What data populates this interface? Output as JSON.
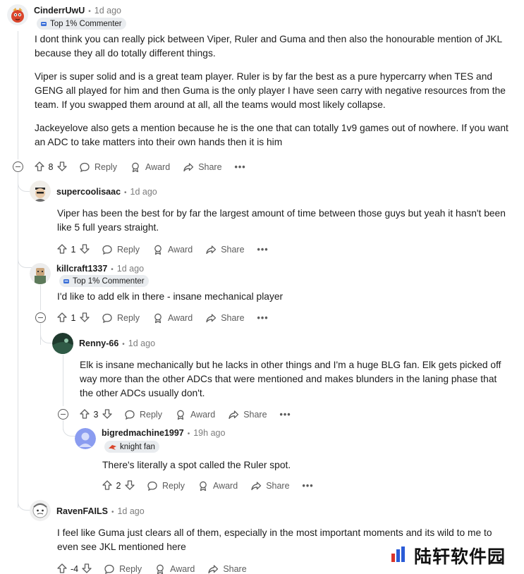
{
  "comments": [
    {
      "author": "CinderrUwU",
      "time": "1d ago",
      "flair": "Top 1% Commenter",
      "paragraphs": [
        "I dont think you can really pick between Viper, Ruler and Guma and then also the honourable mention of JKL because they all do totally different things.",
        "Viper is super solid and is a great team player. Ruler is by far the best as a pure hypercarry when TES and GENG all played for him and then Guma is the only player I have seen carry with negative resources from the team. If you swapped them around at all, all the teams would most likely collapse.",
        "Jackeyelove also gets a mention because he is the one that can totally 1v9 games out of nowhere. If you want an ADC to take matters into their own hands then it is him"
      ],
      "votes": "8"
    },
    {
      "author": "supercoolisaac",
      "time": "1d ago",
      "paragraphs": [
        "Viper has been the best for by far the largest amount of time between those guys but yeah it hasn't been like 5 full years straight."
      ],
      "votes": "1"
    },
    {
      "author": "killcraft1337",
      "time": "1d ago",
      "flair": "Top 1% Commenter",
      "paragraphs": [
        "I'd like to add elk in there - insane mechanical player"
      ],
      "votes": "1"
    },
    {
      "author": "Renny-66",
      "time": "1d ago",
      "paragraphs": [
        "Elk is insane mechanically but he lacks in other things and I'm a huge BLG fan. Elk gets picked off way more than the other ADCs that were mentioned and makes blunders in the laning phase that the other ADCs usually don't."
      ],
      "votes": "3"
    },
    {
      "author": "bigredmachine1997",
      "time": "19h ago",
      "flair": "knight fan",
      "paragraphs": [
        "There's literally a spot called the Ruler spot."
      ],
      "votes": "2"
    },
    {
      "author": "RavenFAILS",
      "time": "1d ago",
      "paragraphs": [
        "I feel like Guma just clears all of them, especially in the most important moments and its wild to me to even see JKL mentioned here"
      ],
      "votes": "-4"
    }
  ],
  "actions": {
    "reply": "Reply",
    "award": "Award",
    "share": "Share",
    "more": "•••"
  },
  "watermark": {
    "text": "陆轩软件园"
  },
  "colors": {
    "text": "#1c1c1c",
    "meta": "#7c7c7c",
    "thread": "#dcdfe3",
    "flair_bg": "#e9ecef"
  }
}
